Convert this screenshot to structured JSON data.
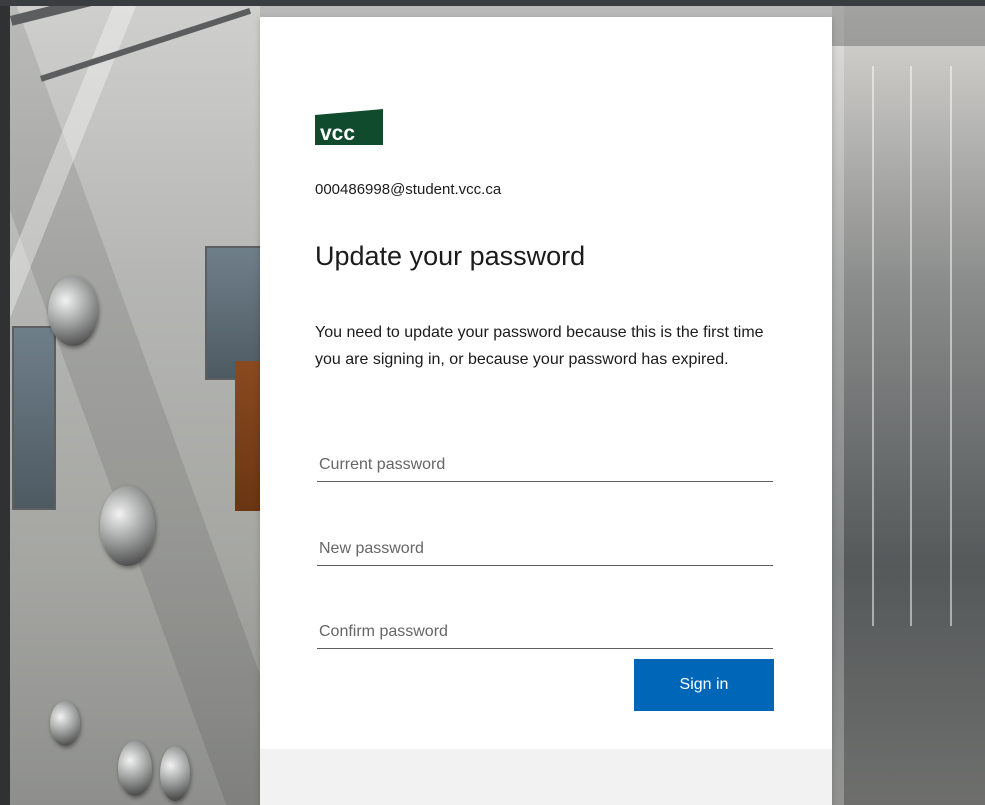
{
  "brand": {
    "logo_text": "vcc",
    "logo_color": "#0f4b2c"
  },
  "account": {
    "email": "000486998@student.vcc.ca"
  },
  "main": {
    "title": "Update your password",
    "description": "You need to update your password because this is the first time you are signing in, or because your password has expired."
  },
  "form": {
    "current_password_placeholder": "Current password",
    "new_password_placeholder": "New password",
    "confirm_password_placeholder": "Confirm password",
    "submit_label": "Sign in"
  },
  "colors": {
    "primary_button": "#0067b8",
    "card_background": "#ffffff",
    "footer_background": "#f2f2f2"
  }
}
